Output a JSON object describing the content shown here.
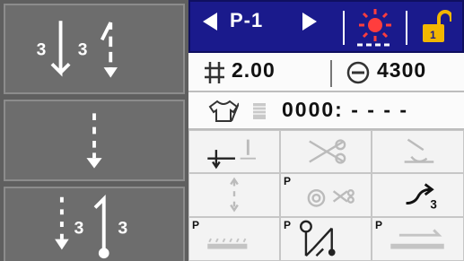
{
  "program": {
    "label": "P-1"
  },
  "stitch_pitch": {
    "value": "2.00"
  },
  "max_speed": {
    "value": "4300"
  },
  "counter": {
    "value": "0000: - - - -"
  },
  "left_modes": [
    {
      "name": "mode-backtack-both",
      "n1": "3",
      "n2": "3"
    },
    {
      "name": "mode-straight"
    },
    {
      "name": "mode-end-backtack",
      "n1": "3",
      "n2": "3"
    }
  ],
  "function_keys": [
    {
      "name": "needle-position-key",
      "p": false
    },
    {
      "name": "thread-trimmer-key",
      "p": false
    },
    {
      "name": "thread-wiper-key",
      "p": false
    },
    {
      "name": "reverse-stitch-key",
      "p": false
    },
    {
      "name": "thread-trim-key",
      "p": true,
      "label": "P"
    },
    {
      "name": "back-tack-count-key",
      "p": false,
      "badge": "3"
    },
    {
      "name": "gathering-key",
      "p": true,
      "label": "P"
    },
    {
      "name": "presser-foot-key",
      "p": true,
      "label": "P"
    },
    {
      "name": "fabric-feed-key",
      "p": true,
      "label": "P"
    }
  ],
  "colors": {
    "header": "#1a1a8c",
    "lock": "#f2b600",
    "left_panel": "#5f5f5f"
  }
}
